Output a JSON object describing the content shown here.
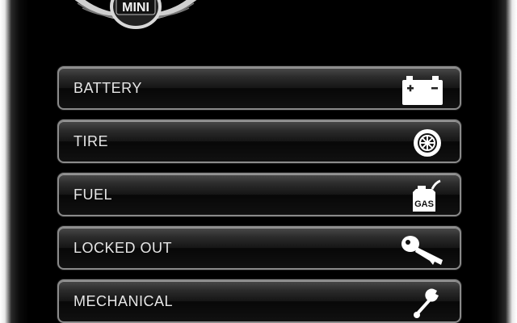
{
  "brand": {
    "logo_text": "MINI"
  },
  "menu": {
    "items": [
      {
        "label": "BATTERY",
        "icon": "battery-icon"
      },
      {
        "label": "TIRE",
        "icon": "tire-icon"
      },
      {
        "label": "FUEL",
        "icon": "gas-can-icon",
        "icon_text": "GAS"
      },
      {
        "label": "LOCKED OUT",
        "icon": "key-icon"
      },
      {
        "label": "MECHANICAL",
        "icon": "wrench-icon"
      }
    ]
  },
  "colors": {
    "background": "#000000",
    "button_border": "#8a8a8a",
    "label": "#e6e6e6",
    "icon": "#ffffff"
  }
}
